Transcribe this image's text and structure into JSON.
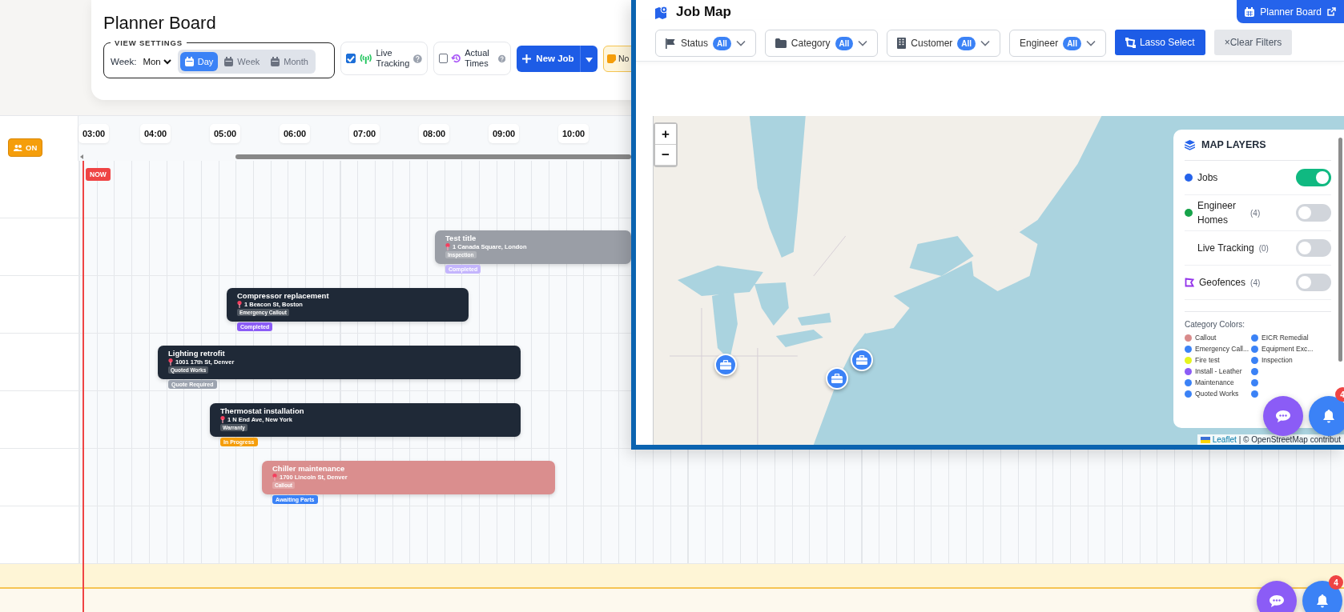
{
  "planner": {
    "title": "Planner Board",
    "view_settings": {
      "legend": "VIEW SETTINGS",
      "week_label": "Week:",
      "week_value": "Mon",
      "modes": [
        {
          "label": "Day",
          "selected": true
        },
        {
          "label": "Week",
          "selected": false
        },
        {
          "label": "Month",
          "selected": false
        }
      ]
    },
    "toggles": [
      {
        "label": "Live Tracking",
        "kind": "tracking",
        "checked": true
      },
      {
        "label": "Actual Times",
        "kind": "history",
        "checked": false
      }
    ],
    "new_job": "New Job",
    "next_button": "No"
  },
  "timeline": {
    "resource_badge": "ON",
    "hours": [
      "03:00",
      "04:00",
      "05:00",
      "06:00",
      "07:00",
      "08:00",
      "09:00",
      "10:00"
    ],
    "now_label": "NOW",
    "jobs": [
      {
        "title": "Test title",
        "address": "1 Canada Square, London",
        "category": "Inspection",
        "color": "#9a9ea6",
        "status": {
          "label": "Completed",
          "color": "#c4b5fd"
        }
      },
      {
        "title": "Compressor replacement",
        "address": "1 Beacon St, Boston",
        "category": "Emergency Callout",
        "color": "#1f2937",
        "status": {
          "label": "Completed",
          "color": "#8b5cf6"
        }
      },
      {
        "title": "Lighting retrofit",
        "address": "1001 17th St, Denver",
        "category": "Quoted Works",
        "color": "#1f2937",
        "status": {
          "label": "Quote Required",
          "color": "#9ca3af"
        }
      },
      {
        "title": "Thermostat installation",
        "address": "1 N End Ave, New York",
        "category": "Warranty",
        "color": "#1f2937",
        "status": {
          "label": "In Progress",
          "color": "#f59e0b"
        }
      },
      {
        "title": "Chiller maintenance",
        "address": "1700 Lincoln St, Denver",
        "category": "Callout",
        "color": "#da8e8e",
        "status": {
          "label": "Awaiting Parts",
          "color": "#3b82f6"
        }
      }
    ]
  },
  "job_map": {
    "title": "Job Map",
    "planner_button": "Planner Board",
    "filters": [
      {
        "label": "Status",
        "badge": "All",
        "kind": "flag"
      },
      {
        "label": "Category",
        "badge": "All",
        "kind": "folder"
      },
      {
        "label": "Customer",
        "badge": "All",
        "kind": "building"
      },
      {
        "label": "Engineer",
        "badge": "All",
        "kind": "none"
      }
    ],
    "lasso_button": "Lasso Select",
    "clear_button": {
      "icon": "×",
      "label": "Clear Filters"
    },
    "zoom_in": "+",
    "zoom_out": "−",
    "layers": {
      "title": "MAP LAYERS",
      "items": [
        {
          "label": "Jobs",
          "kind": "dot",
          "color": "#2563eb",
          "on": true
        },
        {
          "label": "Engineer Homes",
          "count": "(4)",
          "kind": "dot",
          "color": "#16a34a",
          "on": false
        },
        {
          "label": "Live Tracking",
          "count": "(0)",
          "kind": "plain",
          "on": false
        },
        {
          "label": "Geofences",
          "count": "(4)",
          "kind": "geofence",
          "on": false
        }
      ],
      "legend_title": "Category Colors:",
      "categories": [
        {
          "label": "Callout",
          "color": "#d98b8b"
        },
        {
          "label": "EICR Remedial",
          "color": "#3b82f6"
        },
        {
          "label": "Emergency Call...",
          "color": "#3b82f6"
        },
        {
          "label": "Equipment Exc...",
          "color": "#3b82f6"
        },
        {
          "label": "Fire test",
          "color": "#e6f51f"
        },
        {
          "label": "Inspection",
          "color": "#3b82f6"
        },
        {
          "label": "Install - Leather",
          "color": "#8b5cf6"
        },
        {
          "color": "#3b82f6"
        },
        {
          "label": "Maintenance",
          "color": "#3b82f6"
        },
        {
          "color": "#3b82f6"
        },
        {
          "label": "Quoted Works",
          "color": "#3b82f6"
        },
        {
          "color": "#3b82f6"
        }
      ]
    },
    "attribution": {
      "link": "Leaflet",
      "text": "| © OpenStreetMap contribut"
    }
  },
  "floating": {
    "map_badge": "4",
    "page_badge": "4"
  }
}
